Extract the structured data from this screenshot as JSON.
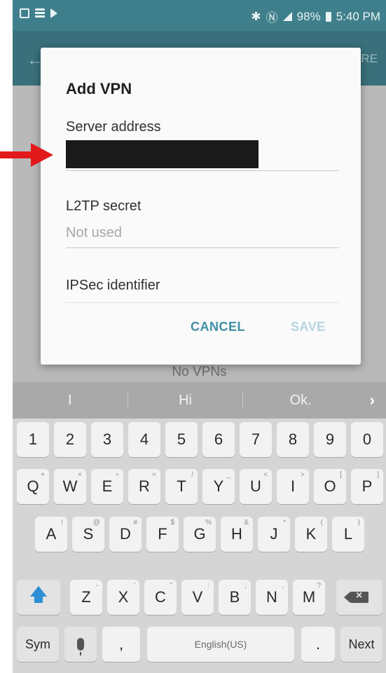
{
  "status_bar": {
    "battery": "98%",
    "time": "5:40 PM"
  },
  "app_bar": {
    "back_icon": "back-arrow-icon",
    "more_label": "RE"
  },
  "background": {
    "no_vpn_text": "No VPNs"
  },
  "dialog": {
    "title": "Add VPN",
    "fields": [
      {
        "label": "Server address",
        "value": "",
        "placeholder": ""
      },
      {
        "label": "L2TP secret",
        "value": "",
        "placeholder": "Not used"
      },
      {
        "label": "IPSec identifier",
        "value": "",
        "placeholder": ""
      }
    ],
    "cancel_label": "CANCEL",
    "save_label": "SAVE",
    "colors": {
      "accent": "#3f8fa6",
      "disabled": "#b5d5df"
    }
  },
  "suggestions": {
    "items": [
      "I",
      "Hi",
      "Ok."
    ],
    "more_icon": "chevron-right-icon"
  },
  "keyboard": {
    "row_numbers": [
      "1",
      "2",
      "3",
      "4",
      "5",
      "6",
      "7",
      "8",
      "9",
      "0"
    ],
    "row1": {
      "keys": [
        "Q",
        "W",
        "E",
        "R",
        "T",
        "Y",
        "U",
        "I",
        "O",
        "P"
      ],
      "hints": [
        "+",
        "×",
        "÷",
        "=",
        "/",
        "_",
        "<",
        ">",
        "[",
        "]"
      ]
    },
    "row2": {
      "keys": [
        "A",
        "S",
        "D",
        "F",
        "G",
        "H",
        "J",
        "K",
        "L"
      ],
      "hints": [
        "!",
        "@",
        "#",
        "$",
        "%",
        "&",
        "*",
        "(",
        ")"
      ]
    },
    "row3": {
      "keys": [
        "Z",
        "X",
        "C",
        "V",
        "B",
        "N",
        "M"
      ],
      "hints": [
        "-",
        "'",
        "\"",
        ":",
        ";",
        ",",
        "?"
      ]
    },
    "sym_label": "Sym",
    "comma_label": ",",
    "space_label": "English(US)",
    "period_label": ".",
    "next_label": "Next",
    "shift_icon": "shift-arrow-icon",
    "mic_icon": "microphone-icon",
    "backspace_icon": "backspace-icon"
  }
}
